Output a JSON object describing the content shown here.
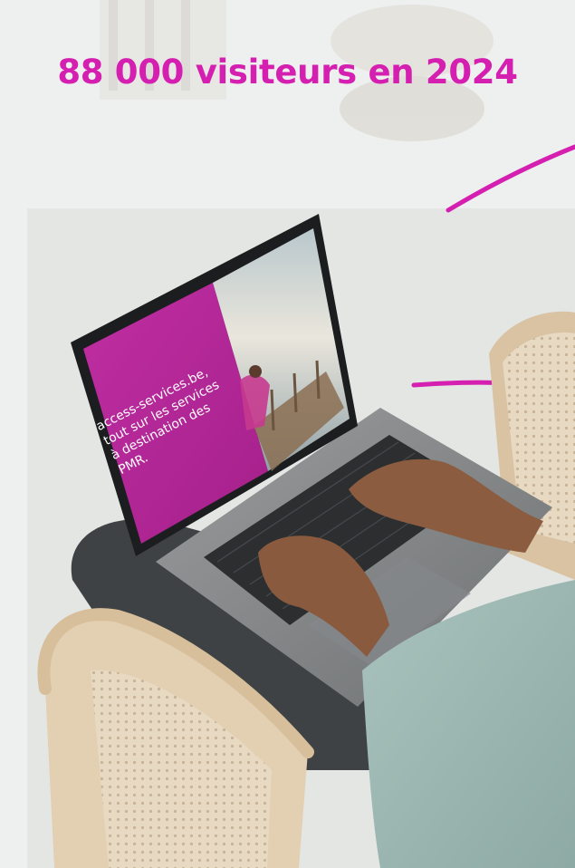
{
  "headline": "88 000 visiteurs en 2024",
  "screen": {
    "line_1": "access-services.be,",
    "line_2": "tout sur les services",
    "line_3": "à destination des",
    "line_4": "PMR."
  },
  "colors": {
    "accent": "#d41fb0",
    "screen_magenta": "#b8279a",
    "background": "#eceeed"
  }
}
